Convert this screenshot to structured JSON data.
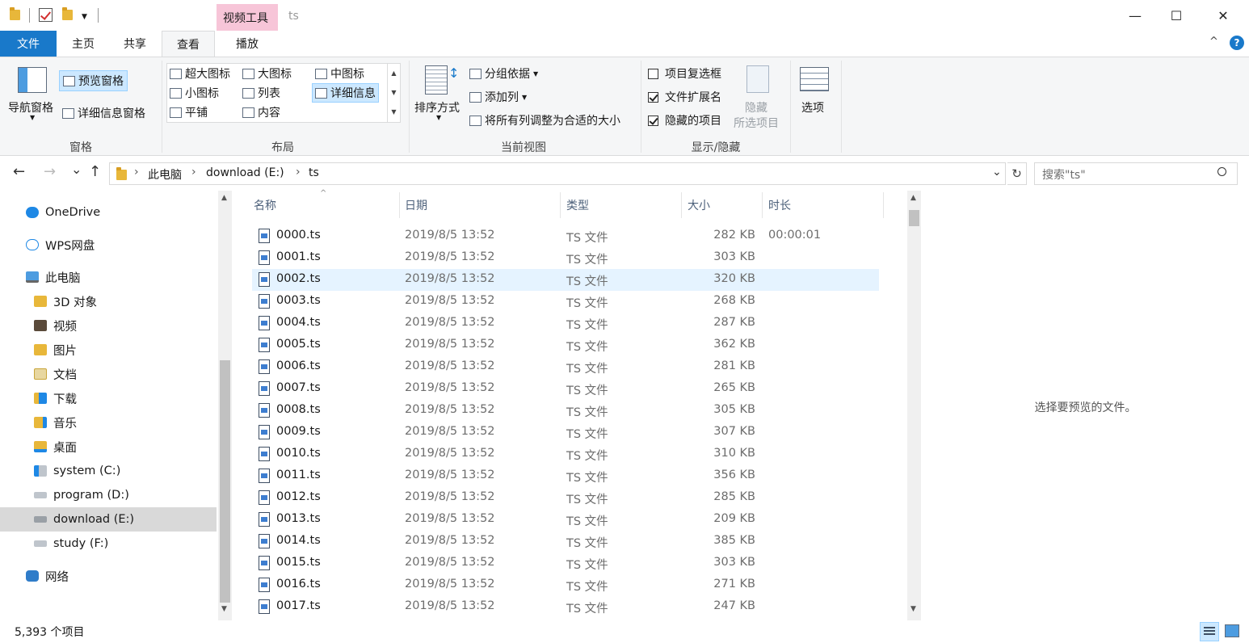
{
  "titlebar": {
    "context_tab": "视频工具",
    "title": "ts",
    "minimize": "—",
    "maximize": "☐",
    "close": "✕"
  },
  "tabs": {
    "file": "文件",
    "home": "主页",
    "share": "共享",
    "view": "查看",
    "play": "播放",
    "collapse": "^",
    "help": "?"
  },
  "ribbon": {
    "pane": {
      "label": "窗格",
      "nav_pane": "导航窗格",
      "preview_pane": "预览窗格",
      "details_pane": "详细信息窗格"
    },
    "layout": {
      "label": "布局",
      "extra_large": "超大图标",
      "large": "大图标",
      "medium": "中图标",
      "small": "小图标",
      "list": "列表",
      "details": "详细信息",
      "tiles": "平铺",
      "content": "内容"
    },
    "current_view": {
      "label": "当前视图",
      "sort_by": "排序方式",
      "group_by": "分组依据",
      "add_columns": "添加列",
      "fit_columns": "将所有列调整为合适的大小"
    },
    "show_hide": {
      "label": "显示/隐藏",
      "item_checkboxes": "项目复选框",
      "file_extensions": "文件扩展名",
      "hidden_items": "隐藏的项目",
      "hide_selected": "隐藏",
      "hide_selected2": "所选项目",
      "item_checkboxes_checked": false,
      "file_extensions_checked": true,
      "hidden_items_checked": true
    },
    "options": "选项"
  },
  "navbar": {
    "back": "←",
    "forward": "→",
    "recent": "⌄",
    "up": "↑",
    "breadcrumb": [
      "此电脑",
      "download (E:)",
      "ts"
    ],
    "search_placeholder": "搜索\"ts\""
  },
  "sidebar": {
    "items": [
      {
        "label": "OneDrive",
        "icon": "cloud-icon"
      },
      {
        "label": "WPS网盘",
        "icon": "cloud-outline-icon"
      },
      {
        "label": "此电脑",
        "icon": "computer-icon"
      },
      {
        "label": "3D 对象",
        "icon": "3d-objects-icon"
      },
      {
        "label": "视频",
        "icon": "video-folder-icon"
      },
      {
        "label": "图片",
        "icon": "pictures-folder-icon"
      },
      {
        "label": "文档",
        "icon": "documents-folder-icon"
      },
      {
        "label": "下载",
        "icon": "downloads-folder-icon"
      },
      {
        "label": "音乐",
        "icon": "music-folder-icon"
      },
      {
        "label": "桌面",
        "icon": "desktop-folder-icon"
      },
      {
        "label": "system (C:)",
        "icon": "system-drive-icon"
      },
      {
        "label": "program (D:)",
        "icon": "drive-icon"
      },
      {
        "label": "download (E:)",
        "icon": "drive-icon"
      },
      {
        "label": "study (F:)",
        "icon": "drive-icon"
      },
      {
        "label": "网络",
        "icon": "network-icon"
      }
    ]
  },
  "list": {
    "columns": {
      "name": "名称",
      "date": "日期",
      "type": "类型",
      "size": "大小",
      "duration": "时长"
    },
    "rows": [
      {
        "name": "0000.ts",
        "date": "2019/8/5 13:52",
        "type": "TS 文件",
        "size": "282 KB",
        "duration": "00:00:01"
      },
      {
        "name": "0001.ts",
        "date": "2019/8/5 13:52",
        "type": "TS 文件",
        "size": "303 KB",
        "duration": ""
      },
      {
        "name": "0002.ts",
        "date": "2019/8/5 13:52",
        "type": "TS 文件",
        "size": "320 KB",
        "duration": ""
      },
      {
        "name": "0003.ts",
        "date": "2019/8/5 13:52",
        "type": "TS 文件",
        "size": "268 KB",
        "duration": ""
      },
      {
        "name": "0004.ts",
        "date": "2019/8/5 13:52",
        "type": "TS 文件",
        "size": "287 KB",
        "duration": ""
      },
      {
        "name": "0005.ts",
        "date": "2019/8/5 13:52",
        "type": "TS 文件",
        "size": "362 KB",
        "duration": ""
      },
      {
        "name": "0006.ts",
        "date": "2019/8/5 13:52",
        "type": "TS 文件",
        "size": "281 KB",
        "duration": ""
      },
      {
        "name": "0007.ts",
        "date": "2019/8/5 13:52",
        "type": "TS 文件",
        "size": "265 KB",
        "duration": ""
      },
      {
        "name": "0008.ts",
        "date": "2019/8/5 13:52",
        "type": "TS 文件",
        "size": "305 KB",
        "duration": ""
      },
      {
        "name": "0009.ts",
        "date": "2019/8/5 13:52",
        "type": "TS 文件",
        "size": "307 KB",
        "duration": ""
      },
      {
        "name": "0010.ts",
        "date": "2019/8/5 13:52",
        "type": "TS 文件",
        "size": "310 KB",
        "duration": ""
      },
      {
        "name": "0011.ts",
        "date": "2019/8/5 13:52",
        "type": "TS 文件",
        "size": "356 KB",
        "duration": ""
      },
      {
        "name": "0012.ts",
        "date": "2019/8/5 13:52",
        "type": "TS 文件",
        "size": "285 KB",
        "duration": ""
      },
      {
        "name": "0013.ts",
        "date": "2019/8/5 13:52",
        "type": "TS 文件",
        "size": "209 KB",
        "duration": ""
      },
      {
        "name": "0014.ts",
        "date": "2019/8/5 13:52",
        "type": "TS 文件",
        "size": "385 KB",
        "duration": ""
      },
      {
        "name": "0015.ts",
        "date": "2019/8/5 13:52",
        "type": "TS 文件",
        "size": "303 KB",
        "duration": ""
      },
      {
        "name": "0016.ts",
        "date": "2019/8/5 13:52",
        "type": "TS 文件",
        "size": "271 KB",
        "duration": ""
      },
      {
        "name": "0017.ts",
        "date": "2019/8/5 13:52",
        "type": "TS 文件",
        "size": "247 KB",
        "duration": ""
      }
    ],
    "selected_index": 2
  },
  "preview": {
    "message": "选择要预览的文件。"
  },
  "status": {
    "item_count": "5,393 个项目"
  },
  "colors": {
    "accent": "#1979ca",
    "selection": "#e5f3ff",
    "context_tab": "#f7c5d8"
  }
}
